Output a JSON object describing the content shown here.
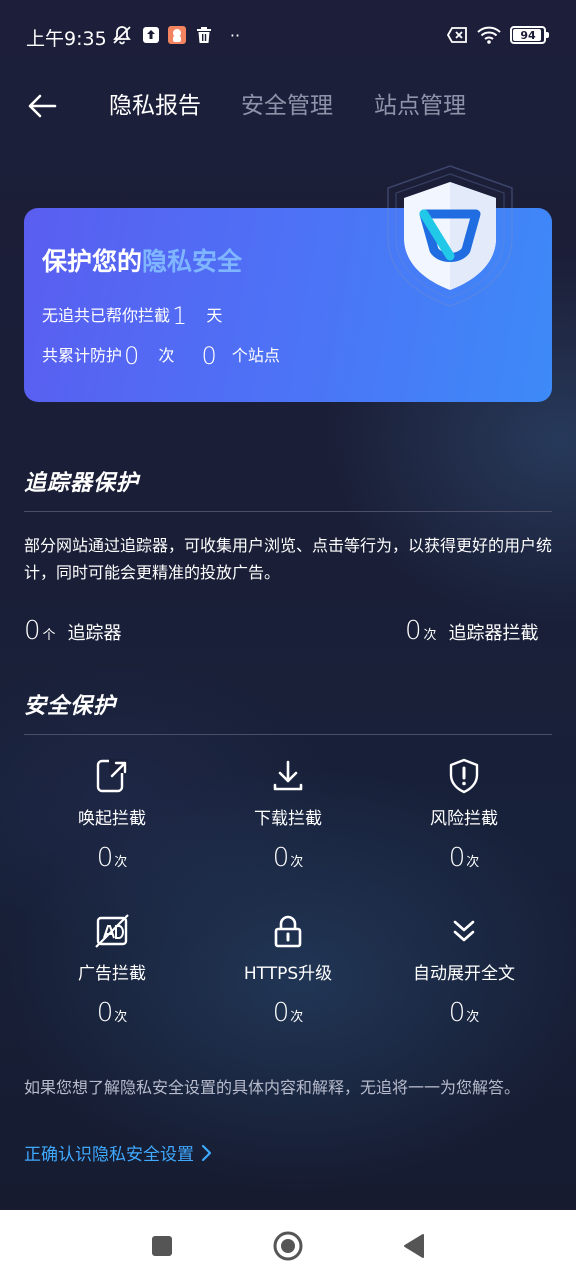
{
  "status_bar": {
    "time": "上午9:35",
    "battery": "94",
    "more": "··"
  },
  "header": {
    "tabs": [
      {
        "label": "隐私报告",
        "active": true
      },
      {
        "label": "安全管理",
        "active": false
      },
      {
        "label": "站点管理",
        "active": false
      }
    ]
  },
  "privacy_card": {
    "title_prefix": "保护您的",
    "title_highlight": "隐私安全",
    "line1_prefix": "无追共已帮你拦截",
    "line1_days": "1",
    "line1_unit": "天",
    "line2_prefix": "共累计防护",
    "line2_count": "0",
    "line2_count_unit": "次",
    "line2_sites": "0",
    "line2_sites_unit": "个站点"
  },
  "tracker_section": {
    "title": "追踪器保护",
    "description": "部分网站通过追踪器，可收集用户浏览、点击等行为，以获得更好的用户统计，同时可能会更精准的投放广告。",
    "trackers": {
      "value": "0",
      "unit": "个",
      "label": "追踪器"
    },
    "blocked": {
      "value": "0",
      "unit": "次",
      "label": "追踪器拦截"
    }
  },
  "security_section": {
    "title": "安全保护",
    "features": [
      {
        "label": "唤起拦截",
        "value": "0",
        "unit": "次",
        "icon": "app-launch-icon"
      },
      {
        "label": "下载拦截",
        "value": "0",
        "unit": "次",
        "icon": "download-icon"
      },
      {
        "label": "风险拦截",
        "value": "0",
        "unit": "次",
        "icon": "shield-alert-icon"
      },
      {
        "label": "广告拦截",
        "value": "0",
        "unit": "次",
        "icon": "ad-block-icon"
      },
      {
        "label": "HTTPS升级",
        "value": "0",
        "unit": "次",
        "icon": "lock-icon"
      },
      {
        "label": "自动展开全文",
        "value": "0",
        "unit": "次",
        "icon": "double-chevron-down-icon"
      }
    ]
  },
  "footer": {
    "text": "如果您想了解隐私安全设置的具体内容和解释，无追将一一为您解答。",
    "link": "正确认识隐私安全设置"
  },
  "colors": {
    "background": "#1a1c33",
    "card_start": "#5a5ef0",
    "card_end": "#3d8af8",
    "highlight": "#7fb6ff",
    "link": "#3fa9ff",
    "inactive_tab": "#8e93a9"
  }
}
